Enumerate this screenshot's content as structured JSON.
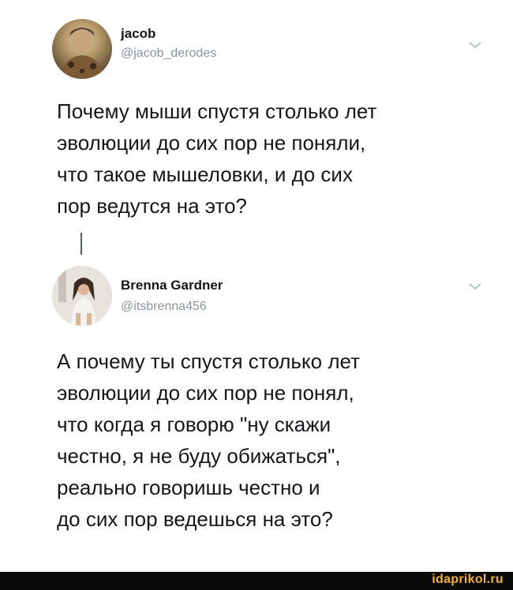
{
  "tweets": [
    {
      "name": "jacob",
      "handle": "@jacob_derodes",
      "lines": [
        "Почему мыши спустя столько лет",
        "эволюции до сих пор не поняли,",
        "что такое мышеловки, и до сих",
        "пор ведутся на это?"
      ]
    },
    {
      "name": "Brenna Gardner",
      "handle": "@itsbrenna456",
      "lines": [
        "А почему ты спустя столько лет",
        "эволюции до сих пор не понял,",
        "что когда я говорю \"ну скажи",
        "честно, я не буду обижаться\",",
        "реально говоришь честно и",
        "до сих пор ведешься на это?"
      ]
    }
  ],
  "icons": {
    "menu": "chevron-down-icon",
    "avatar": "profile-photo"
  },
  "footer": {
    "watermark": "idaprikol.ru"
  },
  "colors": {
    "handle": "#8a949e",
    "text": "#14171a",
    "watermark": "#f2b233",
    "footer_bar": "#0a0a0a"
  }
}
